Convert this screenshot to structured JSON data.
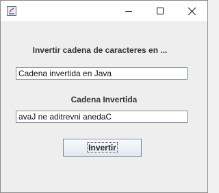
{
  "window": {
    "title": "",
    "icons": {
      "app": "java-app-icon",
      "minimize": "minimize-icon",
      "maximize": "maximize-icon",
      "close": "close-icon"
    }
  },
  "main": {
    "heading": "Invertir cadena de caracteres en ...",
    "input_value": "Cadena invertida en Java",
    "result_heading": "Cadena Invertida",
    "result_value": "avaJ ne aditrevni anedaC",
    "button_label": "Invertir"
  },
  "colors": {
    "background": "#eeeeee",
    "titlebar": "#ffffff",
    "field_border": "#7a8a99"
  }
}
